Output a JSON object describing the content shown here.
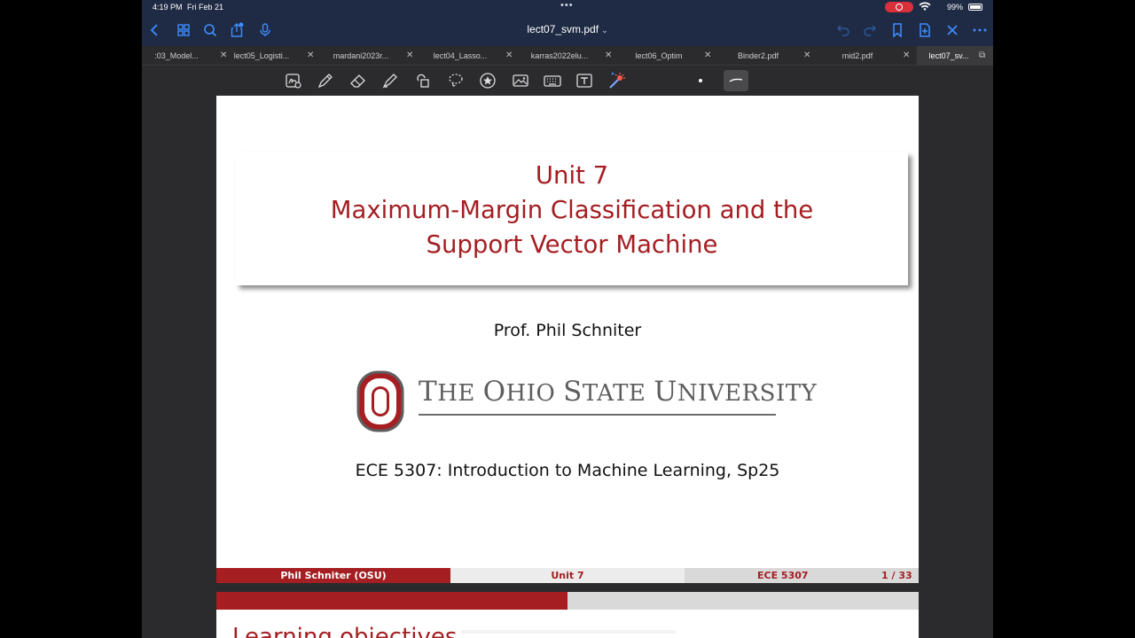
{
  "status_bar": {
    "time": "4:19 PM",
    "date": "Fri Feb 21",
    "battery": "99%"
  },
  "nav": {
    "title": "lect07_svm.pdf",
    "icons": [
      "back-icon",
      "thumbnails-icon",
      "search-icon",
      "share-icon",
      "microphone-icon",
      "undo-icon",
      "redo-icon",
      "bookmark-icon",
      "add-page-icon",
      "close-icon",
      "more-icon"
    ],
    "accent": "#3f8cff",
    "bar_color": "#1f2b44"
  },
  "tabs": [
    {
      "label": ":03_Model..."
    },
    {
      "label": "lect05_Logisti..."
    },
    {
      "label": "mardani2023r..."
    },
    {
      "label": "lect04_Lasso..."
    },
    {
      "label": "karras2022elu..."
    },
    {
      "label": "lect06_Optim"
    },
    {
      "label": "Binder2.pdf"
    },
    {
      "label": "mid2.pdf"
    },
    {
      "label": "lect07_sv..."
    }
  ],
  "toolbar": {
    "tools": [
      "handwriting-icon",
      "pen-icon",
      "eraser-icon",
      "highlighter-icon",
      "shapes-icon",
      "lasso-icon",
      "sticker-icon",
      "image-icon",
      "keyboard-icon",
      "text-box-icon",
      "laser-pointer-icon"
    ]
  },
  "slide": {
    "title_line1": "Unit 7",
    "title_line2": "Maximum-Margin Classification and the",
    "title_line3": "Support Vector Machine",
    "author": "Prof.  Phil Schniter",
    "university_logo_text": "The Ohio State University",
    "course": "ECE 5307:  Introduction to Machine Learning, Sp25",
    "footer_author": "Phil Schniter  (OSU)",
    "footer_unit": "Unit 7",
    "footer_course": "ECE 5307",
    "footer_page": "1 / 33",
    "accent_color": "#a41e22"
  },
  "next_page": {
    "heading_peek": "Learning objectives"
  }
}
